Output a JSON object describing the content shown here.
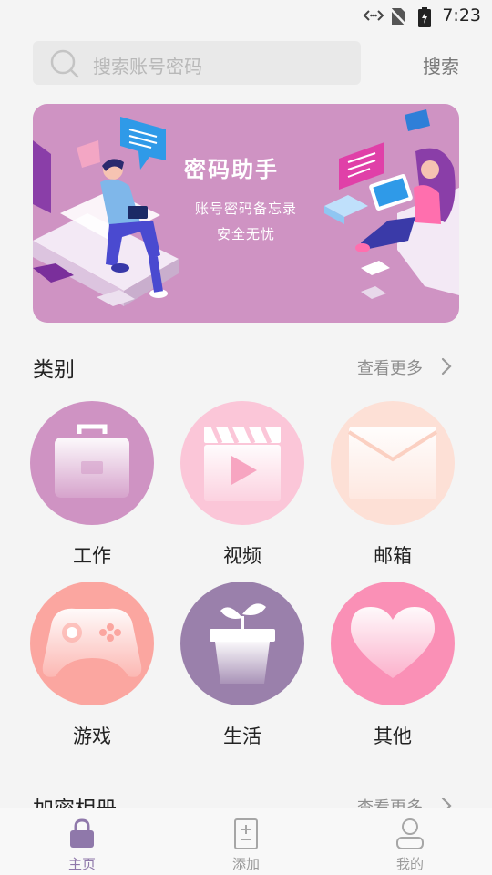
{
  "status_bar": {
    "time": "7:23"
  },
  "search": {
    "placeholder": "搜索账号密码",
    "button_label": "搜索"
  },
  "banner": {
    "title": "密码助手",
    "subtitle_line1": "账号密码备忘录",
    "subtitle_line2": "安全无忧"
  },
  "categories_section": {
    "title": "类别",
    "more_label": "查看更多",
    "items": [
      {
        "label": "工作",
        "icon": "briefcase-icon",
        "color": "#cf93c3"
      },
      {
        "label": "视频",
        "icon": "video-icon",
        "color": "#fbc6d8"
      },
      {
        "label": "邮箱",
        "icon": "mail-icon",
        "color": "#fde0d6"
      },
      {
        "label": "游戏",
        "icon": "gamepad-icon",
        "color": "#fba6a0"
      },
      {
        "label": "生活",
        "icon": "plant-icon",
        "color": "#9a80ab"
      },
      {
        "label": "其他",
        "icon": "heart-icon",
        "color": "#fa90b6"
      }
    ]
  },
  "album_section": {
    "title": "加密相册",
    "more_label": "查看更多"
  },
  "bottom_nav": {
    "items": [
      {
        "label": "主页",
        "icon": "lock-icon",
        "active": true
      },
      {
        "label": "添加",
        "icon": "add-note-icon",
        "active": false
      },
      {
        "label": "我的",
        "icon": "profile-icon",
        "active": false
      }
    ],
    "active_color": "#8f78aa",
    "inactive_color": "#9a9a9a"
  }
}
